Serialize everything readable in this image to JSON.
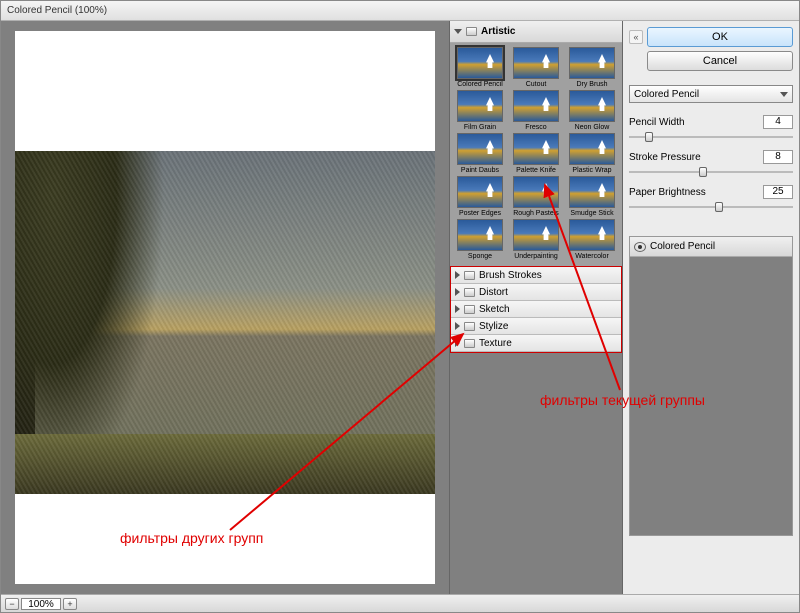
{
  "title": "Colored Pencil (100%)",
  "preview": {
    "zoom": "100%"
  },
  "gallery": {
    "open_category": "Artistic",
    "filters": [
      {
        "label": "Colored Pencil",
        "selected": true
      },
      {
        "label": "Cutout"
      },
      {
        "label": "Dry Brush"
      },
      {
        "label": "Film Grain"
      },
      {
        "label": "Fresco"
      },
      {
        "label": "Neon Glow"
      },
      {
        "label": "Paint Daubs"
      },
      {
        "label": "Palette Knife"
      },
      {
        "label": "Plastic Wrap"
      },
      {
        "label": "Poster Edges"
      },
      {
        "label": "Rough Pastels"
      },
      {
        "label": "Smudge Stick"
      },
      {
        "label": "Sponge"
      },
      {
        "label": "Underpainting"
      },
      {
        "label": "Watercolor"
      }
    ],
    "other_categories": [
      "Brush Strokes",
      "Distort",
      "Sketch",
      "Stylize",
      "Texture"
    ]
  },
  "controls": {
    "ok": "OK",
    "cancel": "Cancel",
    "filter_select": "Colored Pencil",
    "params": [
      {
        "label": "Pencil Width",
        "value": "4",
        "pos": 12
      },
      {
        "label": "Stroke Pressure",
        "value": "8",
        "pos": 45
      },
      {
        "label": "Paper Brightness",
        "value": "25",
        "pos": 55
      }
    ],
    "layer": "Colored Pencil"
  },
  "annotations": {
    "current": "фильтры текущей группы",
    "other": "фильтры других групп"
  }
}
